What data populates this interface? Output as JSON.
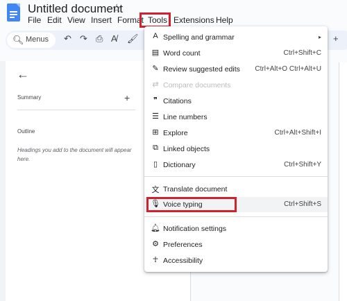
{
  "header": {
    "title": "Untitled document",
    "menus": [
      "File",
      "Edit",
      "View",
      "Insert",
      "Format",
      "Tools",
      "Extensions",
      "Help"
    ]
  },
  "toolbar": {
    "search_label": "Menus"
  },
  "sidebar": {
    "summary_label": "Summary",
    "outline_label": "Outline",
    "outline_hint": "Headings you add to the document will appear here."
  },
  "tools_menu": {
    "items": [
      {
        "label": "Spelling and grammar",
        "shortcut": "",
        "icon": "spellcheck-icon",
        "submenu": true
      },
      {
        "label": "Word count",
        "shortcut": "Ctrl+Shift+C",
        "icon": "word-count-icon"
      },
      {
        "label": "Review suggested edits",
        "shortcut": "Ctrl+Alt+O Ctrl+Alt+U",
        "icon": "review-edits-icon"
      },
      {
        "label": "Compare documents",
        "shortcut": "",
        "icon": "compare-icon",
        "disabled": true
      },
      {
        "label": "Citations",
        "shortcut": "",
        "icon": "quote-icon"
      },
      {
        "label": "Line numbers",
        "shortcut": "",
        "icon": "line-numbers-icon"
      },
      {
        "label": "Explore",
        "shortcut": "Ctrl+Alt+Shift+I",
        "icon": "explore-icon"
      },
      {
        "label": "Linked objects",
        "shortcut": "",
        "icon": "linked-objects-icon"
      },
      {
        "label": "Dictionary",
        "shortcut": "Ctrl+Shift+Y",
        "icon": "dictionary-icon"
      },
      {
        "label": "Translate document",
        "shortcut": "",
        "icon": "translate-icon"
      },
      {
        "label": "Voice typing",
        "shortcut": "Ctrl+Shift+S",
        "icon": "microphone-icon",
        "highlighted": true
      },
      {
        "label": "Notification settings",
        "shortcut": "",
        "icon": "bell-icon"
      },
      {
        "label": "Preferences",
        "shortcut": "",
        "icon": "preferences-icon"
      },
      {
        "label": "Accessibility",
        "shortcut": "",
        "icon": "accessibility-icon"
      }
    ]
  },
  "colors": {
    "highlight_box": "#d0212f",
    "accent": "#4285f4"
  }
}
